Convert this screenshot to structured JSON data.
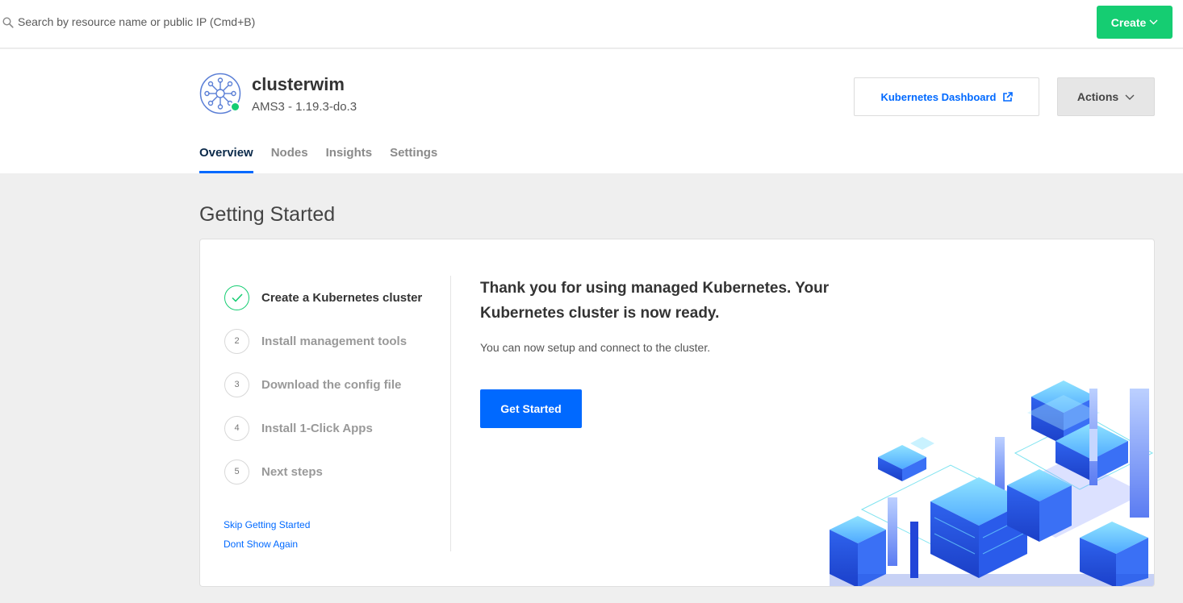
{
  "topbar": {
    "search_placeholder": "Search by resource name or public IP (Cmd+B)",
    "create_label": "Create"
  },
  "cluster": {
    "name": "clusterwim",
    "subtitle": "AMS3 - 1.19.3-do.3",
    "status_color": "#15cd72"
  },
  "header": {
    "dashboard_label": "Kubernetes Dashboard",
    "actions_label": "Actions"
  },
  "tabs": [
    {
      "label": "Overview",
      "active": true
    },
    {
      "label": "Nodes",
      "active": false
    },
    {
      "label": "Insights",
      "active": false
    },
    {
      "label": "Settings",
      "active": false
    }
  ],
  "getting_started": {
    "title": "Getting Started",
    "steps": [
      {
        "number": "",
        "label": "Create a Kubernetes cluster",
        "done": true
      },
      {
        "number": "2",
        "label": "Install management tools",
        "done": false
      },
      {
        "number": "3",
        "label": "Download the config file",
        "done": false
      },
      {
        "number": "4",
        "label": "Install 1-Click Apps",
        "done": false
      },
      {
        "number": "5",
        "label": "Next steps",
        "done": false
      }
    ],
    "skip_label": "Skip Getting Started",
    "dont_show_label": "Dont Show Again",
    "headline": "Thank you for using managed Kubernetes. Your Kubernetes cluster is now ready.",
    "subtext": "You can now setup and connect to the cluster.",
    "button_label": "Get Started"
  },
  "colors": {
    "primary": "#0069ff",
    "success": "#15cd72"
  }
}
